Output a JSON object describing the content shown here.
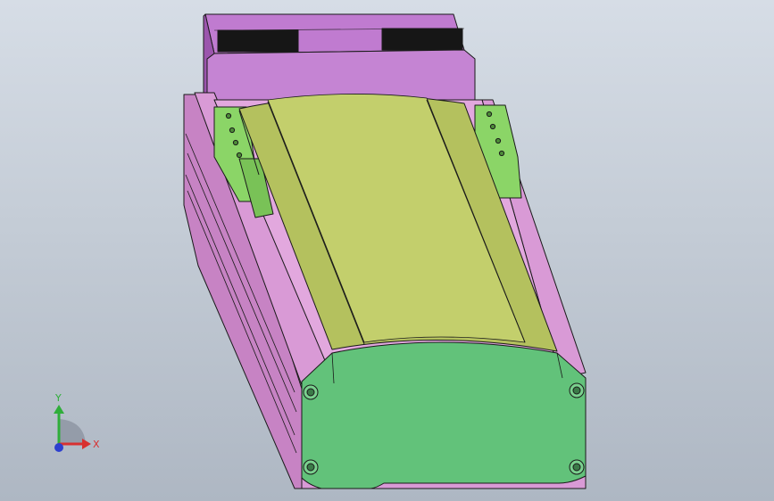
{
  "viewport": {
    "background_top": "#d6dde6",
    "background_bottom": "#aeb7c3"
  },
  "model": {
    "colors": {
      "motor": "#c07bd0",
      "motor_dark": "#9b55ad",
      "rail": "#d99ad6",
      "rail_dark": "#b776b4",
      "carriage": "#b4c15e",
      "carriage_light": "#c3cf6c",
      "end_cap": "#62c27a",
      "bracket": "#8bd567",
      "edge": "#1a1a1a"
    }
  },
  "triad": {
    "x_label": "X",
    "y_label": "Y",
    "x_color": "#d83030",
    "y_color": "#2fae3a",
    "z_color": "#2d3fcf"
  }
}
